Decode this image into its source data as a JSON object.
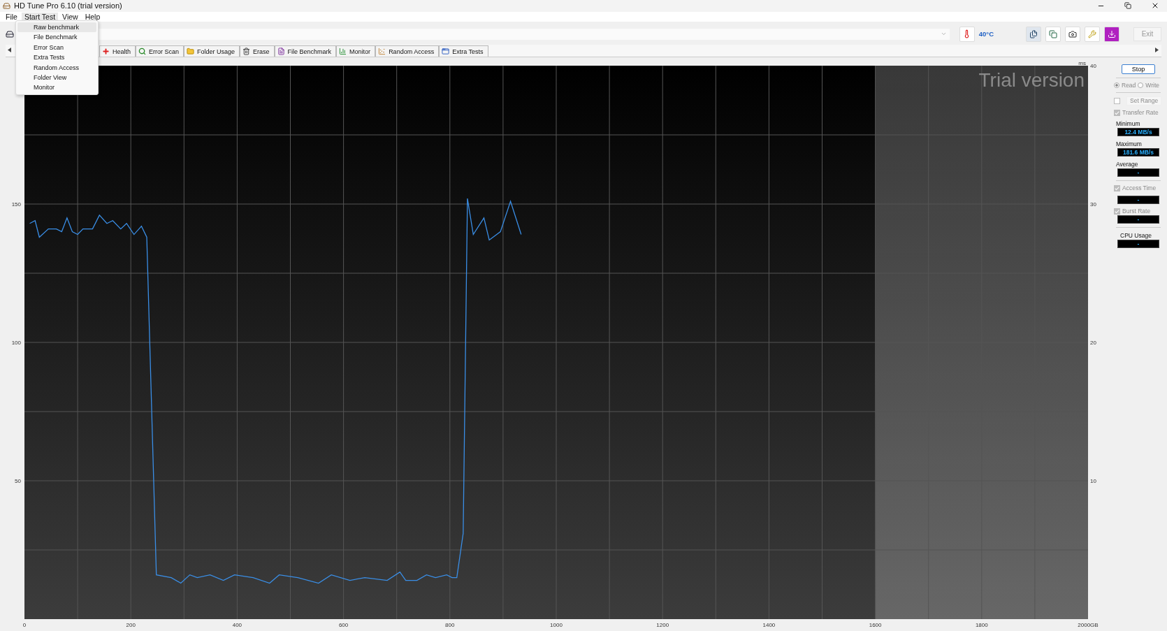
{
  "window": {
    "title": "HD Tune Pro 6.10 (trial version)"
  },
  "menu_bar": [
    {
      "label": "File",
      "selected": false
    },
    {
      "label": "Start Test",
      "selected": true
    },
    {
      "label": "View",
      "selected": false
    },
    {
      "label": "Help",
      "selected": false
    }
  ],
  "open_menu": [
    {
      "label": "Raw benchmark",
      "selected": true
    },
    {
      "label": "File Benchmark",
      "selected": false
    },
    {
      "label": "Error Scan",
      "selected": false
    },
    {
      "label": "Extra Tests",
      "selected": false
    },
    {
      "label": "Random Access",
      "selected": false
    },
    {
      "label": "Folder View",
      "selected": false
    },
    {
      "label": "Monitor",
      "selected": false
    }
  ],
  "toolbar": {
    "temperature": "40°C",
    "exit": "Exit"
  },
  "tabs": [
    {
      "label": "Health"
    },
    {
      "label": "Error Scan"
    },
    {
      "label": "Folder Usage"
    },
    {
      "label": "Erase"
    },
    {
      "label": "File Benchmark"
    },
    {
      "label": "Monitor"
    },
    {
      "label": "Random Access"
    },
    {
      "label": "Extra Tests"
    }
  ],
  "chart": {
    "watermark": "Trial version",
    "right_unit": "ms",
    "right_ticks": [
      "40",
      "30",
      "20",
      "10"
    ],
    "chart_data": {
      "type": "line",
      "grid": true,
      "xlim": [
        0,
        2000
      ],
      "ylim": [
        0,
        200
      ],
      "xticks": [
        0,
        200,
        400,
        600,
        800,
        1000,
        1200,
        1400,
        1600,
        1800,
        {
          "value": 2000,
          "label": "2000GB"
        }
      ],
      "yticks": [
        50,
        100,
        150
      ],
      "x": [
        10,
        20,
        28,
        45,
        60,
        70,
        80,
        90,
        100,
        110,
        128,
        141,
        155,
        166,
        181,
        192,
        206,
        220,
        230,
        248,
        276,
        294,
        311,
        325,
        349,
        374,
        395,
        430,
        461,
        479,
        514,
        553,
        577,
        612,
        640,
        682,
        706,
        717,
        738,
        756,
        773,
        794,
        804,
        813,
        825,
        833,
        844,
        864,
        874,
        895,
        914,
        934
      ],
      "series": [
        {
          "color": "#3a8ee6",
          "values": [
            143,
            144,
            138,
            141,
            141,
            140,
            145,
            140,
            139,
            141,
            141,
            146,
            143,
            144,
            141,
            143,
            139,
            142,
            138,
            16,
            15,
            13,
            16,
            15,
            16,
            14,
            16,
            15,
            13,
            16,
            15,
            13,
            16,
            14,
            15,
            14,
            17,
            14,
            14,
            16,
            15,
            16,
            15,
            15,
            31,
            152,
            139,
            145,
            137,
            140,
            151,
            139
          ]
        }
      ]
    }
  },
  "sidebar": {
    "stop": "Stop",
    "modes": [
      {
        "label": "Read",
        "selected": true
      },
      {
        "label": "Write",
        "selected": false
      }
    ],
    "set_range": {
      "label": "Set Range",
      "checked": false
    },
    "transfer_rate": {
      "label": "Transfer Rate",
      "checked": true
    },
    "minimum": {
      "label": "Minimum",
      "value": "12.4 MB/s"
    },
    "maximum": {
      "label": "Maximum",
      "value": "181.6 MB/s"
    },
    "average": {
      "label": "Average",
      "value": "-"
    },
    "access_time": {
      "label": "Access Time",
      "checked": true,
      "value": "-"
    },
    "burst_rate": {
      "label": "Burst Rate",
      "checked": true,
      "value": "-"
    },
    "cpu_usage": {
      "label": "CPU Usage",
      "value": "-"
    }
  }
}
